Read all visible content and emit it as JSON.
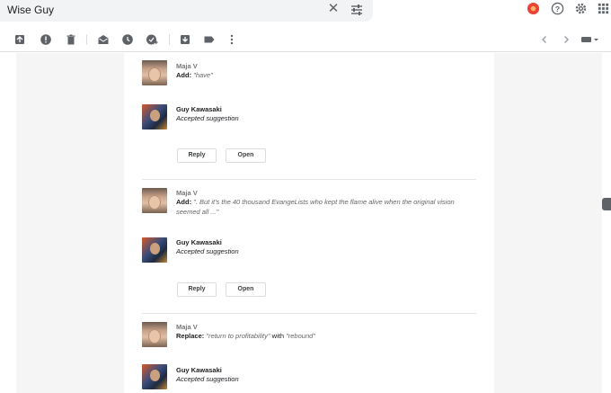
{
  "search": {
    "query": "Wise Guy"
  },
  "colors": {
    "accent_red": "#ea4335",
    "icon_grey": "#5f6368",
    "gutter": "#f5f5f5"
  },
  "comments": [
    {
      "author": "Maja V",
      "action": "Add:",
      "quote": "\"have\"",
      "reply_author": "Guy Kawasaki",
      "reply_text": "Accepted suggestion",
      "reply_button": "Reply",
      "open_button": "Open"
    },
    {
      "author": "Maja V",
      "action": "Add:",
      "quote_line1": "\". But it's the 40 thousand EvangeLists who kept the flame alive when the original vision",
      "quote_line2": "seemed all ...\"",
      "reply_author": "Guy Kawasaki",
      "reply_text": "Accepted suggestion",
      "reply_button": "Reply",
      "open_button": "Open"
    },
    {
      "author": "Maja V",
      "action": "Replace:",
      "quote": "\"return to profitability\"",
      "with_word": "with",
      "replacement": "\"rebound\"",
      "reply_author": "Guy Kawasaki",
      "reply_text": "Accepted suggestion"
    }
  ]
}
